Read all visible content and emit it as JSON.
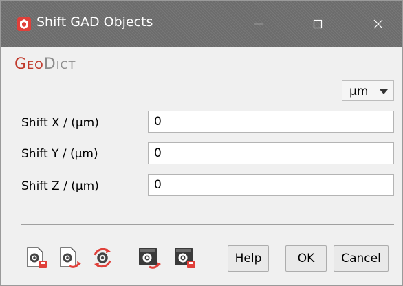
{
  "window": {
    "title": "Shift GAD Objects",
    "app_icon": "geodict-app-icon",
    "controls": [
      "minimize-icon",
      "maximize-icon",
      "close-icon"
    ]
  },
  "logo": {
    "part1_cap": "G",
    "part1_rest": "EO",
    "part2_cap": "D",
    "part2_rest": "ICT",
    "colors": {
      "geo": "#c0392b",
      "dict": "#8c8c8c"
    }
  },
  "unit_select": {
    "value": "µm"
  },
  "fields": [
    {
      "label": "Shift X / (µm)",
      "value": "0"
    },
    {
      "label": "Shift Y / (µm)",
      "value": "0"
    },
    {
      "label": "Shift Z / (µm)",
      "value": "0"
    }
  ],
  "toolbar": {
    "icons": [
      "load-settings-icon",
      "save-settings-icon",
      "reset-settings-icon",
      "save-gdt-icon",
      "load-gdt-icon"
    ]
  },
  "buttons": {
    "help": "Help",
    "ok": "OK",
    "cancel": "Cancel"
  },
  "colors": {
    "accent": "#e0403a",
    "titlebar": "#727272",
    "panel": "#f0f0f0"
  }
}
